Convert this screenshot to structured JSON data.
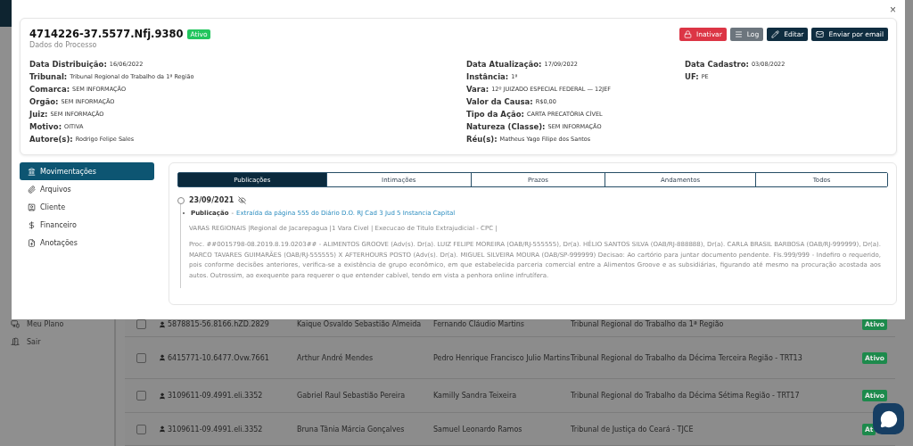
{
  "background": {
    "sidebar_items": [
      {
        "label": "Meu Plano",
        "kind": "plan"
      },
      {
        "label": "Sair",
        "kind": "exit"
      }
    ],
    "rows": [
      {
        "checked": false,
        "process": "5878815-56.8166.hZD.2829",
        "author": "Kaique Osvaldo Sebastião Almeida",
        "defendant": "Fernando Cláudio Martins",
        "court": "Tribunal Regional do Trabalho da 1ª Região",
        "status": "Ativo"
      },
      {
        "checked": false,
        "process": "6415771-10.6477.Ovw.7661",
        "author": "Arthur André Mendes",
        "defendant": "Pedro Henrique Francisco Julio Martins",
        "court": "Tribunal Regional do Trabalho da Décima Terceira Região - TRT13",
        "status": "Ativo"
      },
      {
        "checked": false,
        "process": "3109611-09.4991.eli.3352",
        "author": "Gabriel Raul Sebastião Pereira",
        "defendant": "Kamilly Sandra Teixeira",
        "court": "Tribunal Regional do Trabalho da Décima Sétima Região - TRT17",
        "status": "Ativo"
      },
      {
        "checked": false,
        "process": "3109611-09.4991.eli.3352",
        "author": "Bruna Tânia Márcia Gonçalves",
        "defendant": "Samuel Leonardo Ramos",
        "court": "Tribunal de Justiça do Ceará - TJCE",
        "status": "At"
      }
    ]
  },
  "modal": {
    "close": "×",
    "process_number": "4714226-37.5577.Nfj.9380",
    "status_badge": "Ativo",
    "subtitle": "Dados do Processo",
    "actions": [
      {
        "label": "Inativar",
        "kind": "inactivate"
      },
      {
        "label": "Log",
        "kind": "log"
      },
      {
        "label": "Editar",
        "kind": "edit"
      },
      {
        "label": "Enviar por email",
        "kind": "email"
      }
    ],
    "field_columns": [
      [
        {
          "label": "Data Distribuição:",
          "value": "16/06/2022"
        },
        {
          "label": "Tribunal:",
          "value": "Tribunal Regional do Trabalho da 1ª Região"
        },
        {
          "label": "Comarca:",
          "value": "SEM INFORMAÇÃO"
        },
        {
          "label": "Orgão:",
          "value": "SEM INFORMAÇÃO"
        },
        {
          "label": "Juiz:",
          "value": "SEM INFORMAÇÃO"
        },
        {
          "label": "Motivo:",
          "value": "OITIVA"
        },
        {
          "label": "Autore(s):",
          "value": "Rodrigo Felipe Sales"
        }
      ],
      [
        {
          "label": "Data Atualização:",
          "value": "17/09/2022"
        },
        {
          "label": "Instância:",
          "value": "1ª"
        },
        {
          "label": "Vara:",
          "value": "12º JUIZADO ESPECIAL FEDERAL — 12JEF"
        },
        {
          "label": "Valor da Causa:",
          "value": "R$0,00"
        },
        {
          "label": "Tipo da Ação:",
          "value": "CARTA PRECATÓRIA CÍVEL"
        },
        {
          "label": "Natureza (Classe):",
          "value": "SEM INFORMAÇÃO"
        },
        {
          "label": "Réu(s):",
          "value": "Matheus Yago Filipe dos Santos"
        }
      ],
      [
        {
          "label": "Data Cadastro:",
          "value": "03/08/2022"
        },
        {
          "label": "UF:",
          "value": "PE"
        }
      ]
    ],
    "nav": [
      {
        "label": "Movimentações",
        "kind": "movements",
        "selected": true
      },
      {
        "label": "Arquivos",
        "kind": "files",
        "selected": false
      },
      {
        "label": "Cliente",
        "kind": "client",
        "selected": false
      },
      {
        "label": "Financeiro",
        "kind": "finance",
        "selected": false
      },
      {
        "label": "Anotações",
        "kind": "notes",
        "selected": false
      }
    ],
    "tabs": [
      {
        "label": "Publicações",
        "selected": true
      },
      {
        "label": "Intimações",
        "selected": false
      },
      {
        "label": "Prazos",
        "selected": false
      },
      {
        "label": "Andamentos",
        "selected": false
      },
      {
        "label": "Todos",
        "selected": false
      }
    ],
    "timeline": [
      {
        "date": "23/09/2021",
        "entries": [
          {
            "label": "Publicação",
            "separator": "-",
            "link": "Extraída da página 555 do Diário D.O. RJ Cad 3 Jud 5 Instancia Capital",
            "header": "VARAS REGIONAIS |Regional de Jacarepagua |1 Vara Civel | Execucao de Titulo Extrajudicial - CPC |",
            "body": "Proc. ##0015798-08.2019.8.19.0203## - ALIMENTOS GROOVE (Adv(s). Dr(a). LUIZ FELIPE MOREIRA (OAB/RJ-555555), Dr(a). HÉLIO SANTOS SILVA (OAB/RJ-888888), Dr(a). CARLA BRASIL BARBOSA (OAB/RJ-999999), Dr(a). MARCO TAVARES GUIMARÃES (OAB/RJ-555555) X AFTERHOURS POSTO (Adv(s). Dr(a). MIGUEL SILVEIRA MOURA (OAB/SP-999999) Decisao: Ao cartório para juntar documento pendente. Fls.999/999 - Indefiro o requerido, pois conforme decisões anteriores, verifica-se a existência de grupo econômico, em que estabelecida parceria comercial entre a Alimentos Groove e as subsidiárias, figurando até mesmo na procuração acostada aos autos. Outrossim, ao exequente para requerer o que entender cabível, tendo em vista a penhora online infrutífera."
          }
        ]
      }
    ]
  }
}
